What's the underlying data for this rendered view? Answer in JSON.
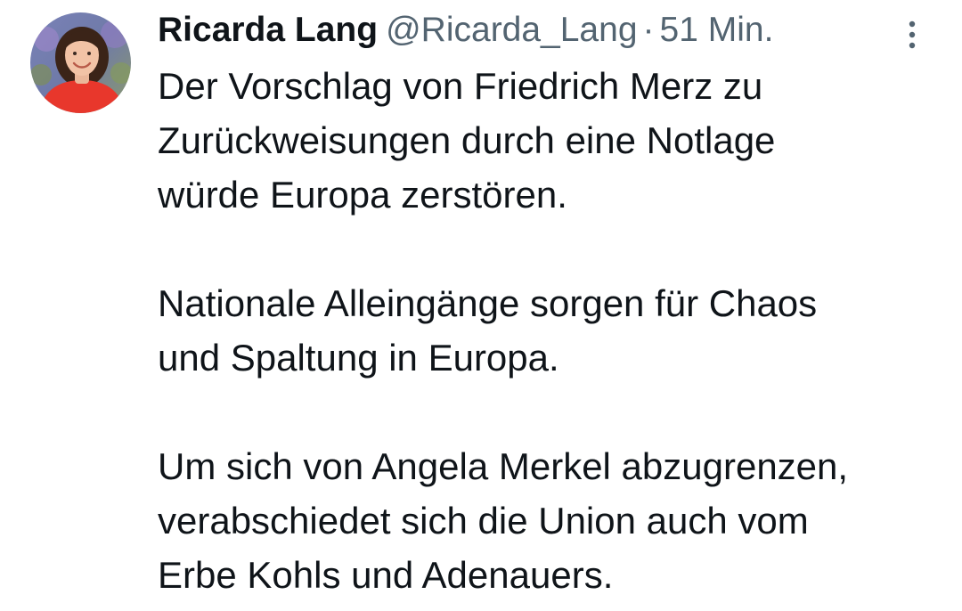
{
  "tweet": {
    "author": {
      "display_name": "Ricarda Lang",
      "handle": "@Ricarda_Lang",
      "avatar_icon": "profile-photo"
    },
    "separator": "·",
    "timestamp": "51 Min.",
    "more_icon": "more-vertical-icon",
    "paragraphs": [
      {
        "lines": [
          "Der Vorschlag von Friedrich Merz zu",
          "Zurückweisungen durch eine Notlage",
          "würde Europa zerstören."
        ]
      },
      {
        "lines": [
          "Nationale Alleingänge sorgen für Chaos",
          "und Spaltung in Europa."
        ]
      },
      {
        "lines": [
          "Um sich von Angela Merkel abzugrenzen,",
          "verabschiedet sich die Union auch vom",
          "Erbe Kohls und Adenauers."
        ]
      }
    ]
  },
  "colors": {
    "text_primary": "#0f1419",
    "text_secondary": "#536471",
    "background": "#ffffff",
    "avatar_shirt": "#e8372c"
  }
}
